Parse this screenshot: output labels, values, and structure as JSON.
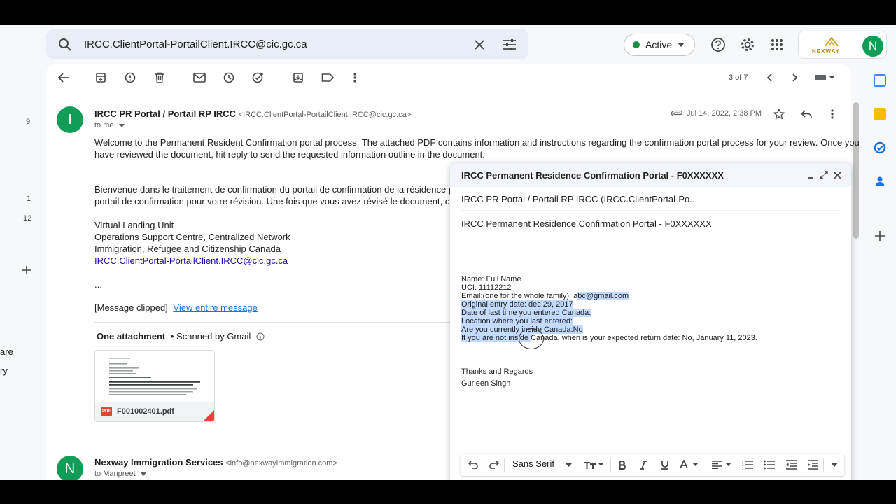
{
  "search": {
    "query": "IRCC.ClientPortal-PortailClient.IRCC@cic.gc.ca"
  },
  "header": {
    "status_label": "Active",
    "avatar_letter": "N",
    "logo_text": "NEXWAY"
  },
  "left_rail": {
    "counts": [
      "9",
      "1",
      "12"
    ],
    "labels": [
      "are",
      "ry"
    ]
  },
  "pager": {
    "text": "3 of 7"
  },
  "message1": {
    "avatar_letter": "I",
    "sender_name": "IRCC PR Portal / Portail RP IRCC",
    "sender_addr": "<IRCC.ClientPortal-PortailClient.IRCC@cic.gc.ca>",
    "to": "to me",
    "date": "Jul 14, 2022, 2:38 PM",
    "body_en_1": "Welcome to the Permanent Resident Confirmation portal process. The attached PDF contains information and instructions regarding the confirmation portal process for your review. Once you",
    "body_en_2": "have reviewed the document, hit reply to send the requested information outline in the document.",
    "body_fr_1": "Bienvenue dans le traitement de confirmation du portail de confirmation de la résidence perm",
    "body_fr_2": "portail de confirmation pour votre révision. Une fois que vous avez révisé le document, clique",
    "sig_1": "Virtual Landing Unit",
    "sig_2": "Operations Support Centre, Centralized Network",
    "sig_3": "Immigration, Refugee and Citizenship Canada",
    "sig_link": "IRCC.ClientPortal-PortailClient.IRCC@cic.gc.ca",
    "ellipsis": "...",
    "clipped": "[Message clipped]",
    "view_entire": "View entire message",
    "attach_title": "One attachment",
    "attach_scanned": "• Scanned by Gmail",
    "attach_file": "F001002401.pdf",
    "pdf_badge": "PDF"
  },
  "message2": {
    "avatar_letter": "N",
    "sender_name": "Nexway Immigration Services",
    "sender_addr": "<info@nexwayimmigration.com>",
    "to": "to Manpreet"
  },
  "compose": {
    "title": "IRCC Permanent Residence Confirmation Portal - F0XXXXXX",
    "to": "IRCC PR Portal / Portail RP IRCC (IRCC.ClientPortal-Po...",
    "subject": "IRCC Permanent Residence Confirmation Portal - F0XXXXXX",
    "line_name": "Name: Full Name",
    "line_uci": "UCI: 11112212",
    "line_email_a": "Email:(one for the whole family): a",
    "line_email_b": "bc@gmail.com",
    "line_entry": "Original entry date: dec 29, 2017",
    "line_last": "Date of last time you entered Canada:",
    "line_location": "Location where you last entered:",
    "line_inside": "Are you currently inside Canada:No",
    "line_notinside_a": "If you are not inside ",
    "line_notinside_b": "Canada, when is your expected return date:  No, January 11, 2023.",
    "thanks": "Thanks and Regards",
    "name": "Gurleen Singh",
    "font_select": "Sans Serif"
  },
  "colors": {
    "accent_blue": "#1a73e8",
    "green": "#0f9d58",
    "highlight": "#c2dbff"
  }
}
